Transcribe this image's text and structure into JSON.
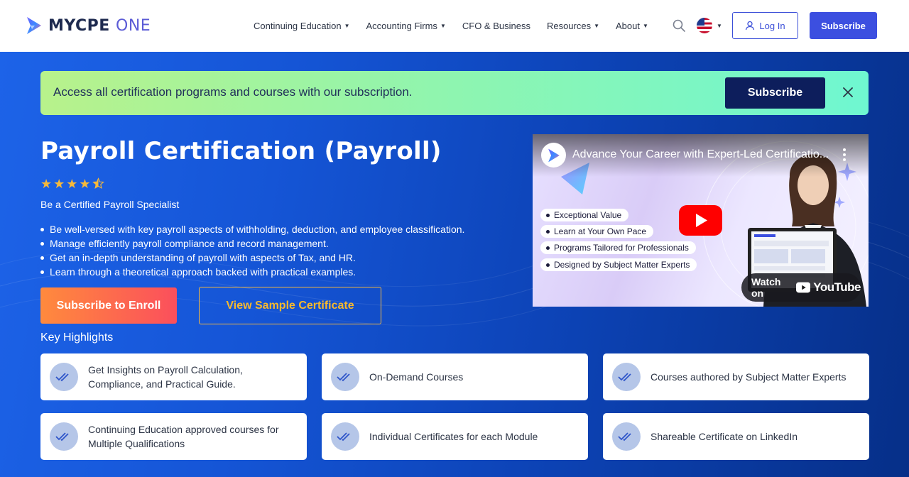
{
  "header": {
    "logo_main": "MYCPE",
    "logo_accent": "ONE",
    "nav": [
      {
        "label": "Continuing Education",
        "has_dropdown": true
      },
      {
        "label": "Accounting Firms",
        "has_dropdown": true
      },
      {
        "label": "CFO & Business",
        "has_dropdown": false
      },
      {
        "label": "Resources",
        "has_dropdown": true
      },
      {
        "label": "About",
        "has_dropdown": true
      }
    ],
    "search_icon": "search-icon",
    "language_icon": "us-flag-icon",
    "login_label": "Log In",
    "subscribe_label": "Subscribe"
  },
  "promo": {
    "text": "Access all certification programs and courses with our subscription.",
    "button_label": "Subscribe",
    "close_icon": "close-icon"
  },
  "course": {
    "title": "Payroll Certification (Payroll)",
    "rating": 4.5,
    "rating_max": 5,
    "subtitle": "Be a Certified Payroll Specialist",
    "bullets": [
      "Be well-versed with key payroll aspects of withholding, deduction, and employee classification.",
      "Manage efficiently payroll compliance and record management.",
      "Get an in-depth understanding of payroll with aspects of Tax, and HR.",
      "Learn through a theoretical approach backed with practical examples."
    ],
    "enroll_label": "Subscribe to Enroll",
    "sample_label": "View Sample Certificate"
  },
  "video": {
    "title": "Advance Your Career with Expert-Led Certificatio...",
    "tags": [
      "Exceptional Value",
      "Learn at Your Own Pace",
      "Programs Tailored for Professionals",
      "Designed by Subject Matter Experts"
    ],
    "watch_on_label": "Watch on",
    "youtube_label": "YouTube"
  },
  "highlights": {
    "title": "Key Highlights",
    "items": [
      "Get Insights on Payroll Calculation, Compliance, and Practical Guide.",
      "On-Demand Courses",
      "Courses authored by Subject Matter Experts",
      "Continuing Education approved courses for Multiple Qualifications",
      "Individual Certificates for each Module",
      "Shareable Certificate on LinkedIn"
    ]
  },
  "colors": {
    "brand_blue": "#3c4fe0",
    "hero_start": "#1d63e8",
    "hero_end": "#062f88",
    "enroll_orange": "#ff8a3d",
    "enroll_red": "#fb4f5c",
    "sample_gold": "#f7b92e",
    "star": "#f6b93b"
  }
}
